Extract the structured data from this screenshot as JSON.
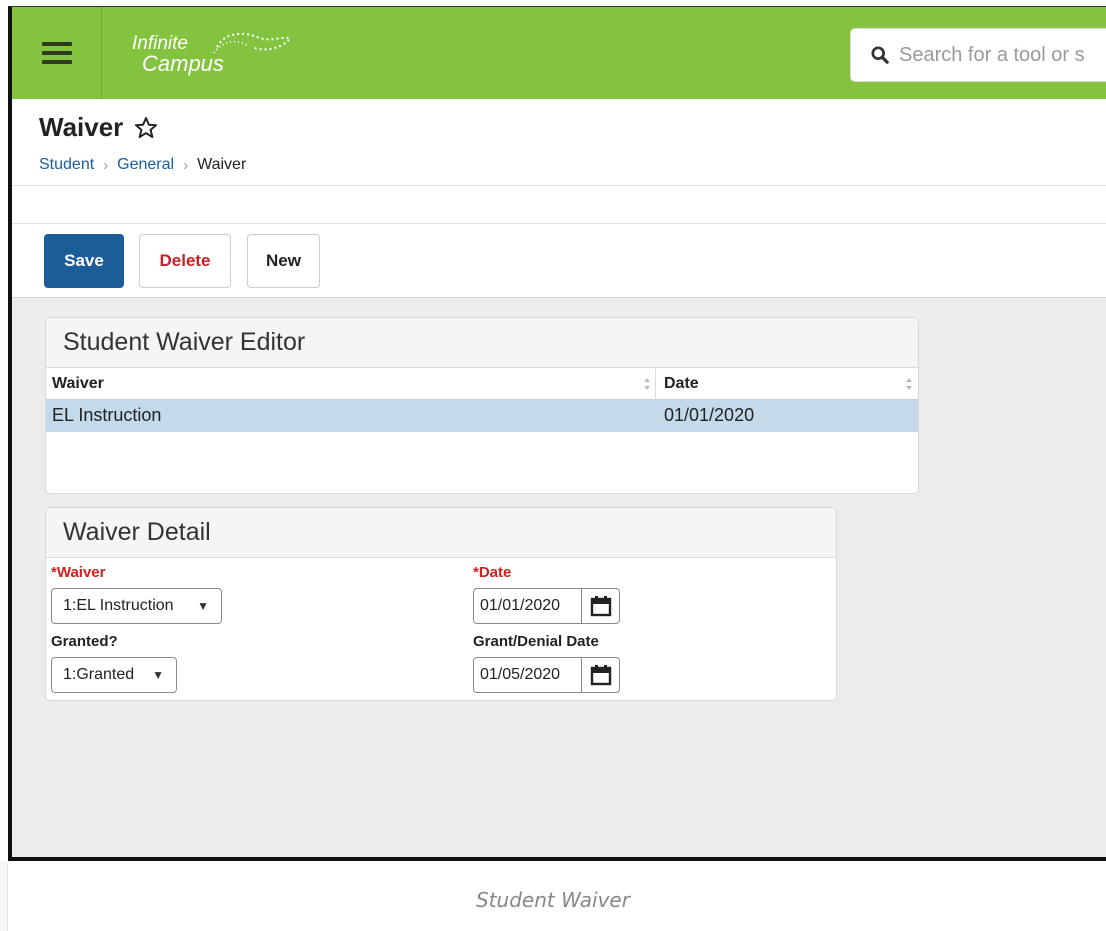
{
  "app": {
    "logo_text_top": "Infinite",
    "logo_text_bottom": "Campus",
    "brand_color": "#84c340",
    "primary_color": "#1c5c97",
    "danger_color": "#c52127"
  },
  "search": {
    "placeholder": "Search for a tool or s",
    "icon": "search-icon"
  },
  "header": {
    "title": "Waiver",
    "breadcrumb": [
      "Student",
      "General",
      "Waiver"
    ]
  },
  "toolbar": {
    "save_label": "Save",
    "delete_label": "Delete",
    "new_label": "New"
  },
  "editor": {
    "title": "Student Waiver Editor",
    "columns": [
      "Waiver",
      "Date"
    ],
    "rows": [
      {
        "waiver": "EL Instruction",
        "date": "01/01/2020"
      }
    ]
  },
  "detail": {
    "title": "Waiver Detail",
    "waiver_label": "*Waiver",
    "waiver_value": "1:EL Instruction",
    "date_label": "*Date",
    "date_value": "01/01/2020",
    "granted_label": "Granted?",
    "granted_value": "1:Granted",
    "grant_denial_label": "Grant/Denial Date",
    "grant_denial_value": "01/05/2020"
  },
  "caption": "Student Waiver"
}
